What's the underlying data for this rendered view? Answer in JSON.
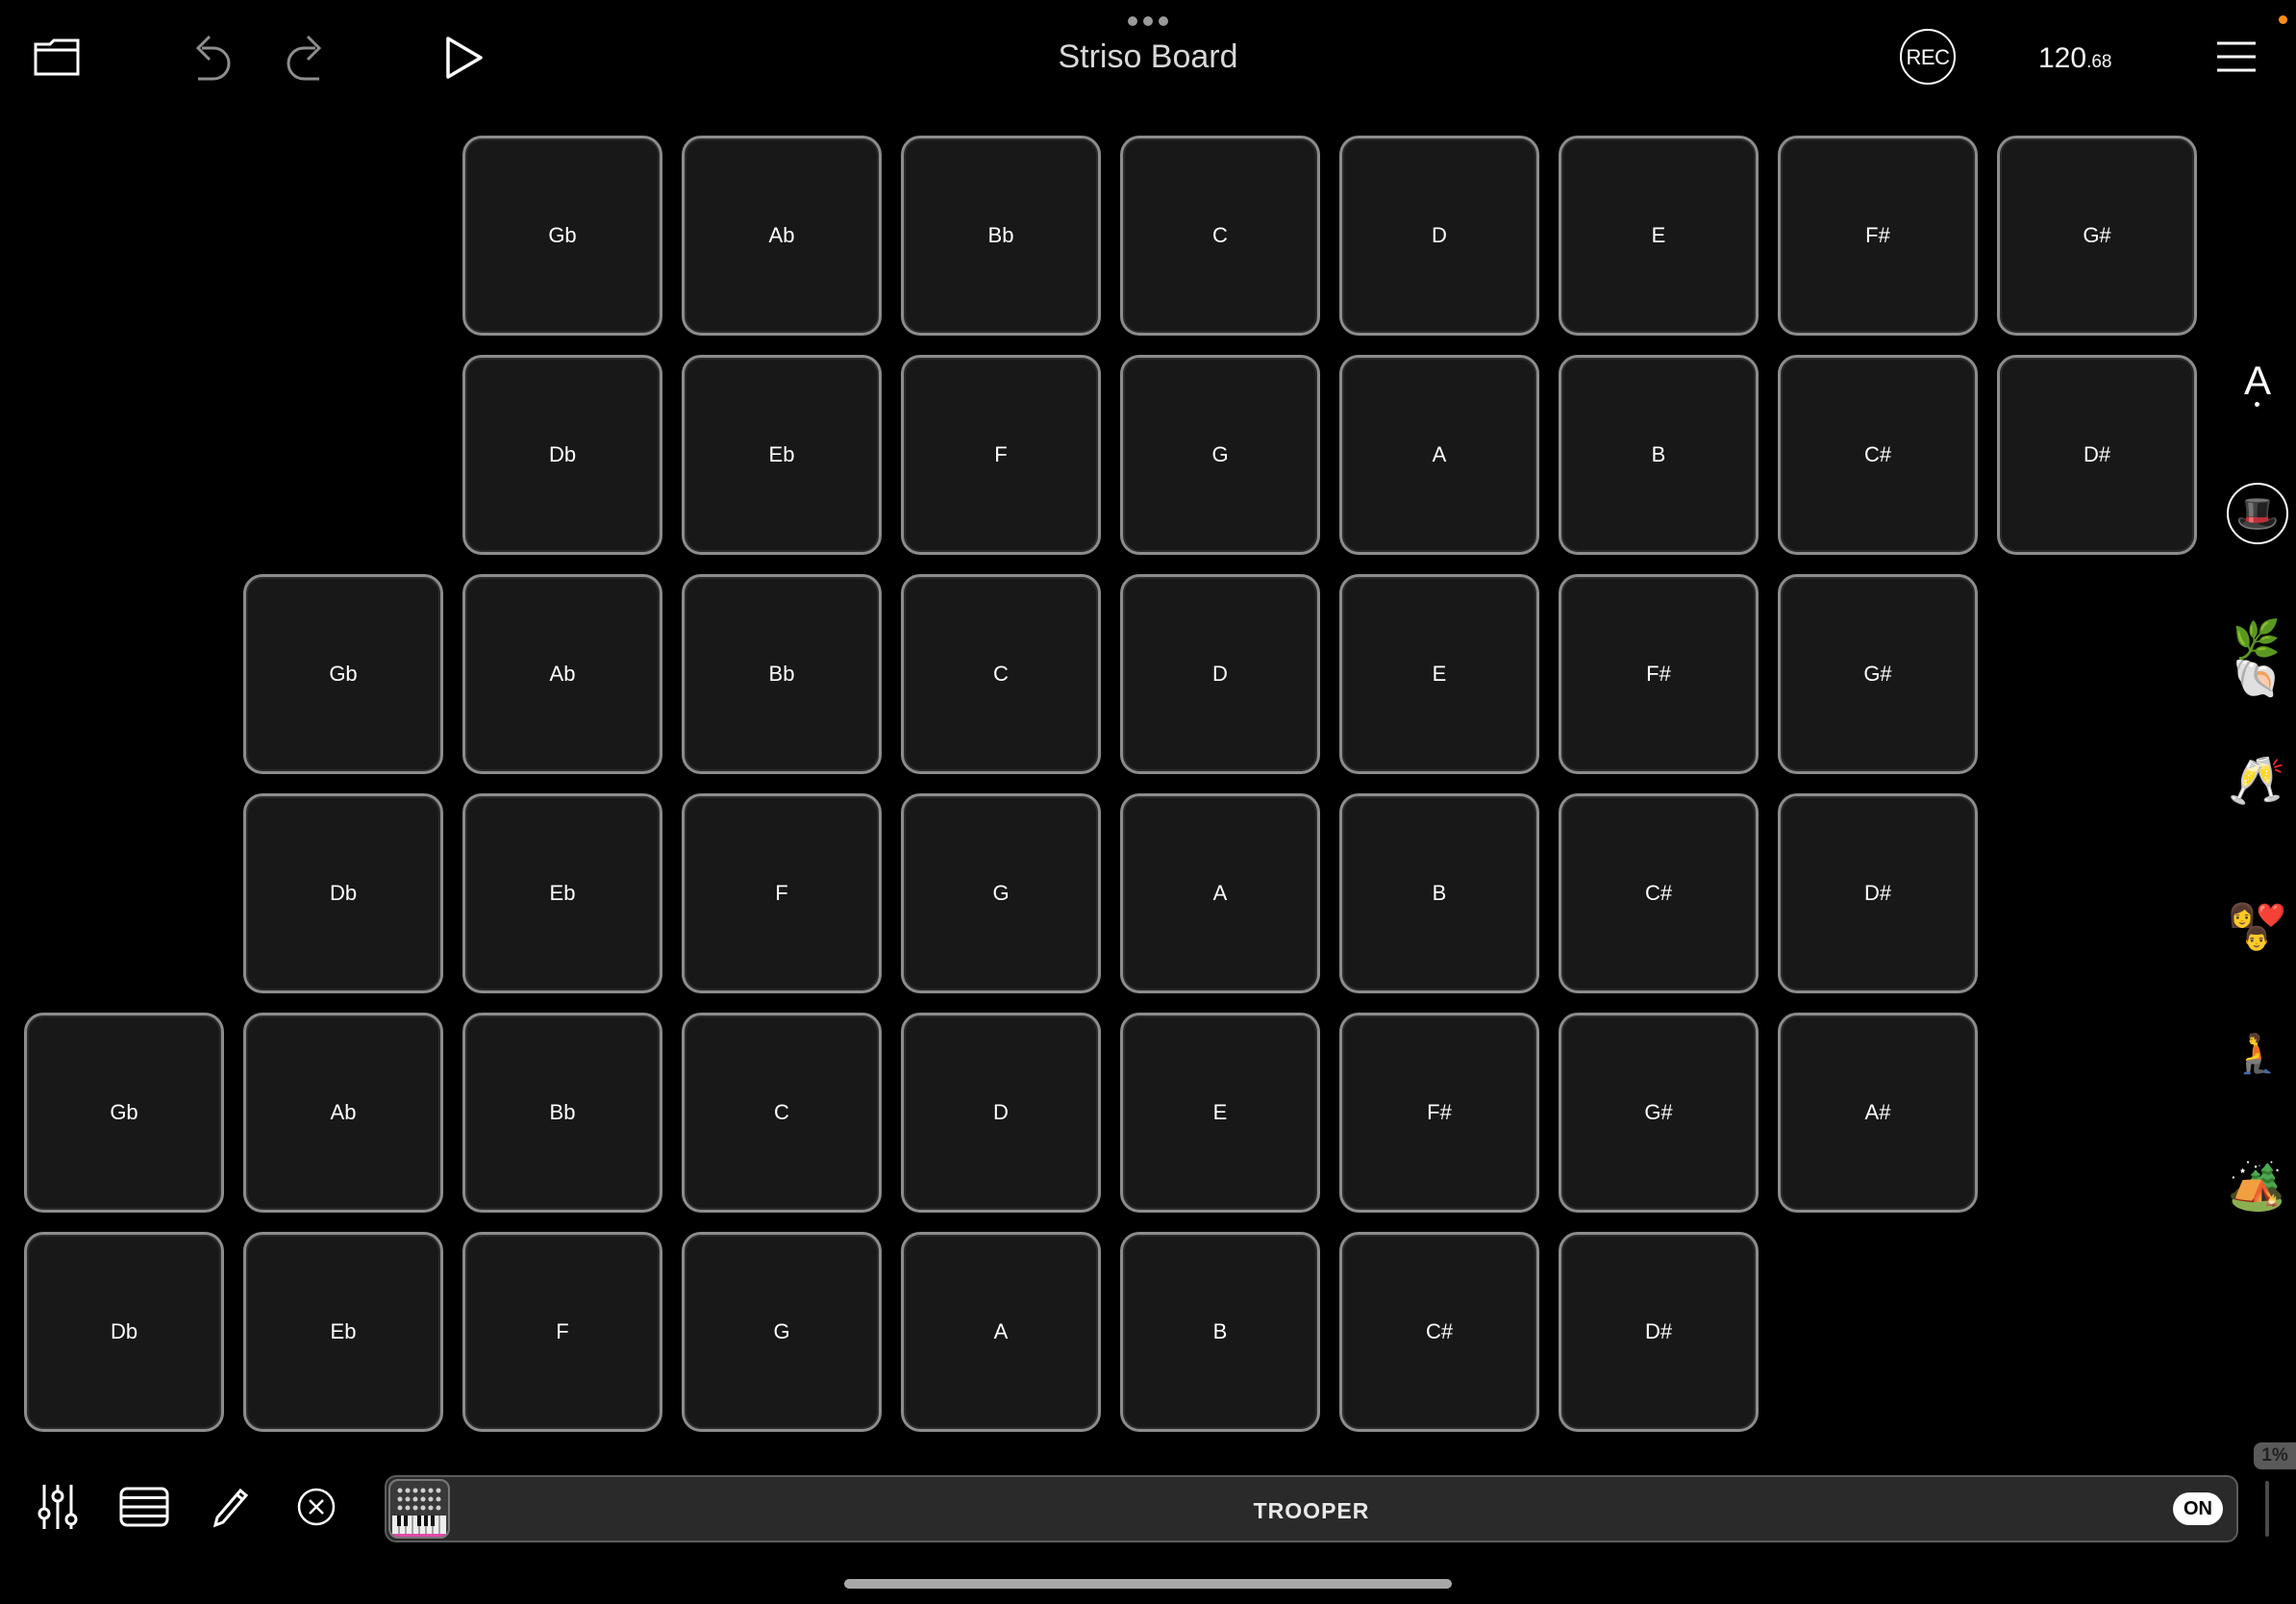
{
  "header": {
    "title": "Striso Board",
    "rec_label": "REC",
    "tempo_main": "120",
    "tempo_fraction": ".68"
  },
  "pad_rows": [
    [
      "Gb",
      "Ab",
      "Bb",
      "C",
      "D",
      "E",
      "F#",
      "G#"
    ],
    [
      "Db",
      "Eb",
      "F",
      "G",
      "A",
      "B",
      "C#",
      "D#"
    ],
    [
      "Gb",
      "Ab",
      "Bb",
      "C",
      "D",
      "E",
      "F#",
      "G#"
    ],
    [
      "Db",
      "Eb",
      "F",
      "G",
      "A",
      "B",
      "C#",
      "D#"
    ],
    [
      "Gb",
      "Ab",
      "Bb",
      "C",
      "D",
      "E",
      "F#",
      "G#",
      "A#"
    ],
    [
      "Db",
      "Eb",
      "F",
      "G",
      "A",
      "B",
      "C#",
      "D#"
    ]
  ],
  "sidebar": {
    "key_letter": "A",
    "emojis": [
      "🎩",
      "🌿🐚",
      "🥂",
      "👩❤️👨",
      "🧎",
      "🏕️"
    ]
  },
  "instrument": {
    "name": "TROOPER",
    "power_label": "ON"
  },
  "cpu": {
    "label": "1%"
  },
  "icons": {
    "folder": "folder-icon",
    "undo": "undo-icon",
    "redo": "redo-icon",
    "play": "play-icon",
    "menu": "hamburger-menu-icon",
    "mixer": "mixer-sliders-icon",
    "list": "stacked-list-icon",
    "edit": "pencil-icon",
    "close": "close-circle-icon"
  }
}
